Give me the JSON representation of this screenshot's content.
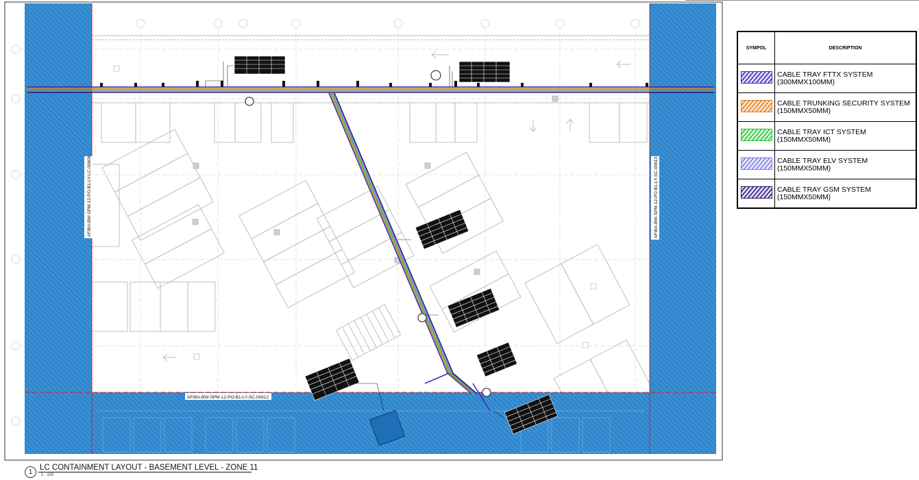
{
  "drawing": {
    "title": "LC CONTAINMENT LAYOUT - BASEMENT LEVEL - ZONE 11",
    "detail_number": "1",
    "scale": "1 : 100",
    "match_lines": {
      "left": "AFIBA-BW-SPM-12-PO-B1-LY-LC-00609",
      "right": "AFIBA-BW-SPM-12-PO-B1-LY-SC-00613",
      "bottom": "AFIBA-BW-SPM-12-PO-B1-LY-SC-00612"
    },
    "colors": {
      "match_zone": "#2f86cc",
      "match_line": "#d32020",
      "plan_lines": "#b8b8b8",
      "tray_fttx": "#3a2fb5",
      "tray_security": "#f0932b",
      "tray_ict": "#2ed63c",
      "tray_elv": "#8f8ff0",
      "tray_gsm": "#3e1f8c"
    }
  },
  "legend": {
    "header_symbol": "SYMPOL",
    "header_description": "DESCRIPTION",
    "items": [
      {
        "name": "CABLE TRAY FTTX SYSTEM",
        "size": "(300MMX100MM)",
        "color": "#3a2fb5",
        "fill": "#d9d6f7"
      },
      {
        "name": "CABLE TRUNKING SECURITY SYSTEM",
        "size": "(150MMX50MM)",
        "color": "#e07b1c",
        "fill": "#fbe2c8"
      },
      {
        "name": "CABLE TRAY ICT SYSTEM",
        "size": "(150MMX50MM)",
        "color": "#22c433",
        "fill": "#d4f7d6"
      },
      {
        "name": "CABLE TRAY ELV SYSTEM",
        "size": "(150MMX50MM)",
        "color": "#7b7be8",
        "fill": "#e3e3fb"
      },
      {
        "name": "CABLE TRAY GSM SYSTEM",
        "size": "(150MMX50MM)",
        "color": "#2e1675",
        "fill": "#ddd5f0"
      }
    ]
  }
}
